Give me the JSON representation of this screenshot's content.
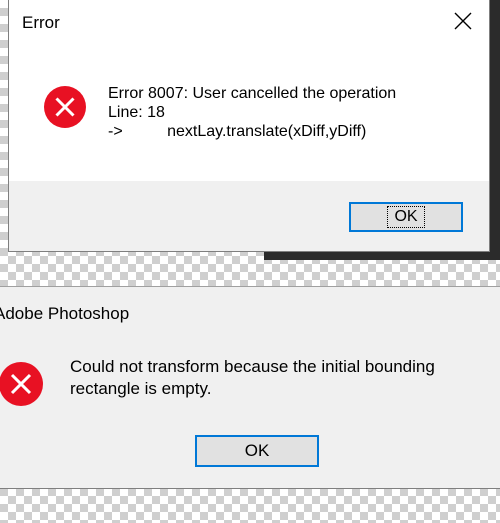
{
  "dialog1": {
    "title": "Error",
    "message_lines": [
      "Error 8007: User cancelled the operation",
      "Line: 18",
      "->          nextLay.translate(xDiff,yDiff)"
    ],
    "ok_label": "OK"
  },
  "dialog2": {
    "title": "Adobe Photoshop",
    "message_lines": [
      "Could not transform because the initial bounding",
      "rectangle is empty."
    ],
    "ok_label": "OK"
  },
  "colors": {
    "error_icon": "#e81123",
    "focus_border": "#0078d7",
    "dialog_bg": "#f0f0f0"
  },
  "icons": {
    "error": "error-icon",
    "close": "close-icon"
  }
}
